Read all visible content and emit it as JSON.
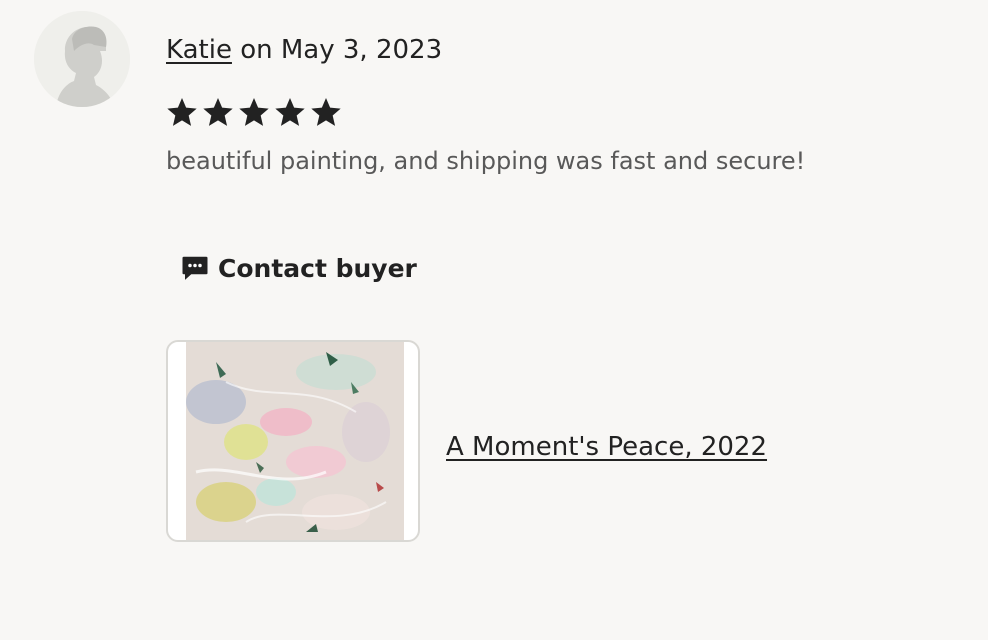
{
  "review": {
    "reviewer_name": "Katie",
    "date_text": "on May 3, 2023",
    "rating": 5,
    "rating_max": 5,
    "text": "beautiful painting, and shipping was fast and secure!"
  },
  "actions": {
    "contact_label": "Contact buyer"
  },
  "listing": {
    "title": "A Moment's Peace, 2022"
  },
  "colors": {
    "background": "#f8f7f5",
    "star": "#222222",
    "review_text": "#595959"
  },
  "icons": {
    "avatar": "default-avatar-icon",
    "star": "star-icon",
    "contact": "chat-bubble-icon"
  }
}
